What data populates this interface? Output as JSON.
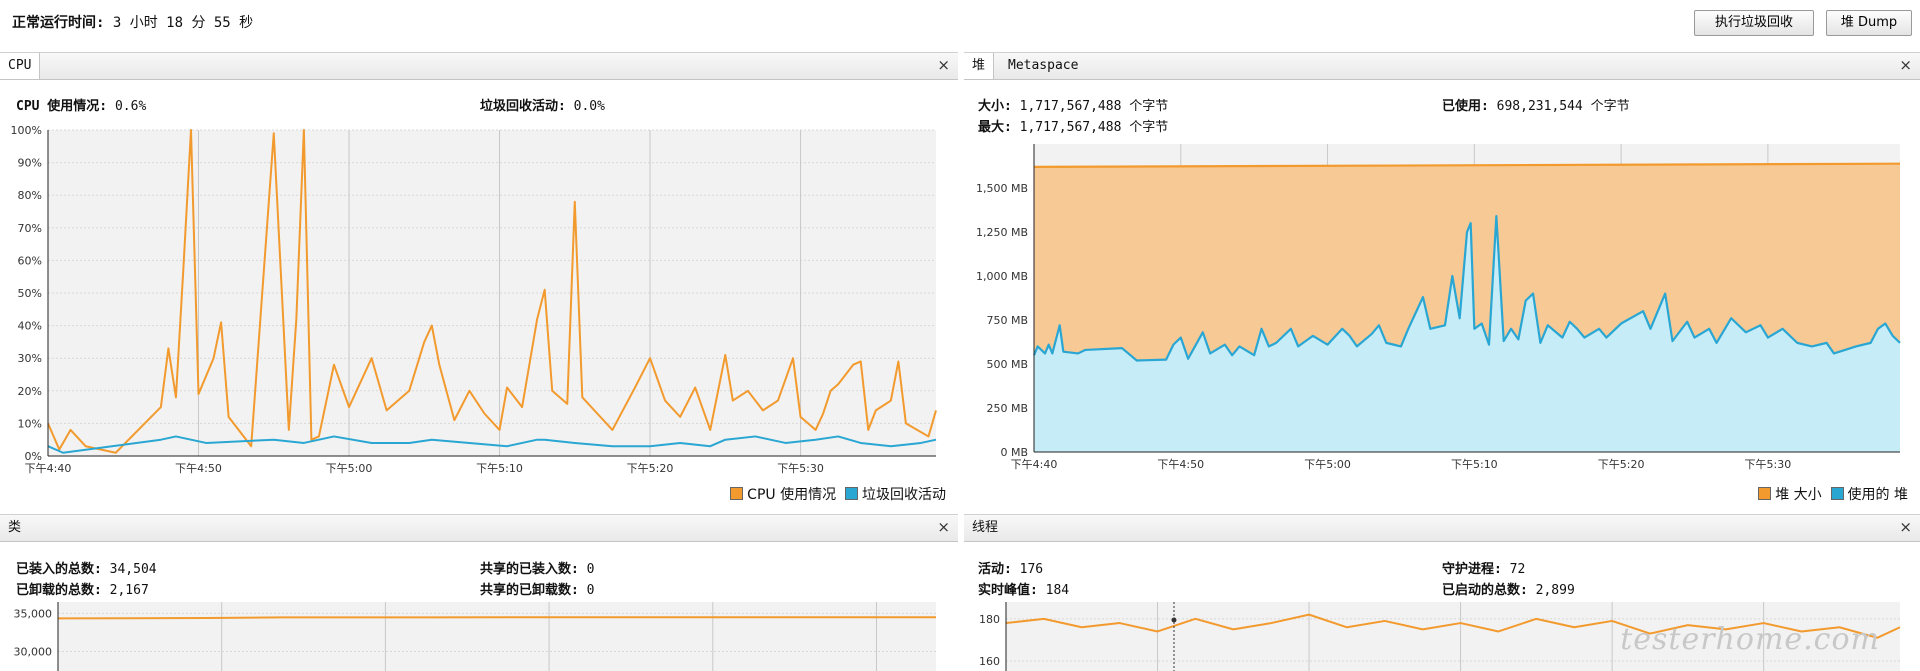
{
  "header": {
    "uptime_label": "正常运行时间:",
    "uptime_value": "3 小时 18 分 55 秒",
    "gc_button": "执行垃圾回收",
    "dump_button": "堆 Dump"
  },
  "cpu_panel": {
    "tab": "CPU",
    "close": "×",
    "cpu_usage_label": "CPU 使用情况:",
    "cpu_usage_value": "0.6%",
    "gc_activity_label": "垃圾回收活动:",
    "gc_activity_value": "0.0%",
    "legend_cpu": "CPU 使用情况",
    "legend_gc": "垃圾回收活动"
  },
  "heap_panel": {
    "tab_heap": "堆",
    "tab_metaspace": "Metaspace",
    "close": "×",
    "size_label": "大小:",
    "size_value": "1,717,567,488 个字节",
    "used_label": "已使用:",
    "used_value": "698,231,544 个字节",
    "max_label": "最大:",
    "max_value": "1,717,567,488 个字节",
    "legend_size": "堆 大小",
    "legend_used": "使用的 堆"
  },
  "classes_panel": {
    "tab": "类",
    "close": "×",
    "loaded_label": "已装入的总数:",
    "loaded_value": "34,504",
    "unloaded_label": "已卸载的总数:",
    "unloaded_value": "2,167",
    "shared_loaded_label": "共享的已装入数:",
    "shared_loaded_value": "0",
    "shared_unloaded_label": "共享的已卸载数:",
    "shared_unloaded_value": "0"
  },
  "threads_panel": {
    "tab": "线程",
    "close": "×",
    "live_label": "活动:",
    "live_value": "176",
    "daemon_label": "守护进程:",
    "daemon_value": "72",
    "peak_label": "实时峰值:",
    "peak_value": "184",
    "started_label": "已启动的总数:",
    "started_value": "2,899"
  },
  "watermark": "testerhome.com",
  "colors": {
    "orange": "#f29a2e",
    "blue": "#2aa6d3",
    "heap_fill": "#f7c995",
    "used_fill": "#c6ecf8"
  },
  "chart_data": [
    {
      "type": "area",
      "title": "CPU",
      "x_ticks": [
        "下午4:40",
        "下午4:50",
        "下午5:00",
        "下午5:10",
        "下午5:20",
        "下午5:30"
      ],
      "y_ticks": [
        "0%",
        "10%",
        "20%",
        "30%",
        "40%",
        "50%",
        "60%",
        "70%",
        "80%",
        "90%",
        "100%"
      ],
      "ylim": [
        0,
        100
      ],
      "series": [
        {
          "name": "CPU 使用情况",
          "color": "#f29a2e",
          "points": [
            [
              0,
              10
            ],
            [
              1.5,
              2
            ],
            [
              3,
              8
            ],
            [
              5,
              3
            ],
            [
              9,
              1
            ],
            [
              15,
              15
            ],
            [
              16,
              33
            ],
            [
              17,
              18
            ],
            [
              18,
              58
            ],
            [
              19,
              100
            ],
            [
              20,
              19
            ],
            [
              22,
              30
            ],
            [
              23,
              41
            ],
            [
              24,
              12
            ],
            [
              27,
              3
            ],
            [
              30,
              99
            ],
            [
              32,
              8
            ],
            [
              33,
              42
            ],
            [
              34,
              100
            ],
            [
              35,
              5
            ],
            [
              36,
              6
            ],
            [
              38,
              28
            ],
            [
              40,
              15
            ],
            [
              43,
              30
            ],
            [
              45,
              14
            ],
            [
              48,
              20
            ],
            [
              50,
              35
            ],
            [
              51,
              40
            ],
            [
              52,
              28
            ],
            [
              54,
              11
            ],
            [
              56,
              20
            ],
            [
              58,
              13
            ],
            [
              60,
              8
            ],
            [
              61,
              21
            ],
            [
              63,
              15
            ],
            [
              65,
              42
            ],
            [
              66,
              51
            ],
            [
              67,
              20
            ],
            [
              69,
              16
            ],
            [
              70,
              78
            ],
            [
              71,
              18
            ],
            [
              73,
              13
            ],
            [
              75,
              8
            ],
            [
              78,
              21
            ],
            [
              80,
              30
            ],
            [
              82,
              17
            ],
            [
              84,
              12
            ],
            [
              86,
              21
            ],
            [
              88,
              8
            ],
            [
              90,
              31
            ],
            [
              91,
              17
            ],
            [
              93,
              20
            ],
            [
              95,
              14
            ],
            [
              97,
              17
            ],
            [
              99,
              30
            ],
            [
              100,
              12
            ],
            [
              102,
              8
            ],
            [
              103,
              13
            ],
            [
              104,
              20
            ],
            [
              105,
              22
            ],
            [
              107,
              28
            ],
            [
              108,
              29
            ],
            [
              109,
              8
            ],
            [
              110,
              14
            ],
            [
              112,
              17
            ],
            [
              113,
              29
            ],
            [
              114,
              10
            ],
            [
              117,
              6
            ],
            [
              118,
              14
            ]
          ]
        },
        {
          "name": "垃圾回收活动",
          "color": "#2aa6d3",
          "points": [
            [
              0,
              3
            ],
            [
              2,
              1
            ],
            [
              15,
              5
            ],
            [
              17,
              6
            ],
            [
              19,
              5
            ],
            [
              21,
              4
            ],
            [
              30,
              5
            ],
            [
              34,
              4
            ],
            [
              38,
              6
            ],
            [
              43,
              4
            ],
            [
              48,
              4
            ],
            [
              51,
              5
            ],
            [
              56,
              4
            ],
            [
              61,
              3
            ],
            [
              65,
              5
            ],
            [
              66,
              5
            ],
            [
              70,
              4
            ],
            [
              75,
              3
            ],
            [
              80,
              3
            ],
            [
              84,
              4
            ],
            [
              88,
              3
            ],
            [
              90,
              5
            ],
            [
              94,
              6
            ],
            [
              98,
              4
            ],
            [
              102,
              5
            ],
            [
              105,
              6
            ],
            [
              108,
              4
            ],
            [
              112,
              3
            ],
            [
              116,
              4
            ],
            [
              118,
              5
            ]
          ]
        }
      ]
    },
    {
      "type": "area",
      "title": "堆",
      "x_ticks": [
        "下午4:40",
        "下午4:50",
        "下午5:00",
        "下午5:10",
        "下午5:20",
        "下午5:30"
      ],
      "y_ticks": [
        "0 MB",
        "250 MB",
        "500 MB",
        "750 MB",
        "1,000 MB",
        "1,250 MB",
        "1,500 MB"
      ],
      "ylim": [
        0,
        1750
      ],
      "series": [
        {
          "name": "堆 大小",
          "color": "#f29a2e",
          "points": [
            [
              0,
              1620
            ],
            [
              118,
              1638
            ]
          ]
        },
        {
          "name": "使用的 堆",
          "color": "#2aa6d3",
          "points": [
            [
              0,
              550
            ],
            [
              0.5,
              600
            ],
            [
              1.5,
              560
            ],
            [
              2,
              610
            ],
            [
              2.5,
              560
            ],
            [
              3,
              640
            ],
            [
              3.5,
              720
            ],
            [
              4,
              570
            ],
            [
              6,
              560
            ],
            [
              7,
              580
            ],
            [
              12,
              590
            ],
            [
              14,
              520
            ],
            [
              18,
              525
            ],
            [
              19,
              610
            ],
            [
              20,
              650
            ],
            [
              21,
              530
            ],
            [
              23,
              680
            ],
            [
              24,
              560
            ],
            [
              26,
              610
            ],
            [
              27,
              550
            ],
            [
              28,
              600
            ],
            [
              30,
              550
            ],
            [
              31,
              700
            ],
            [
              32,
              600
            ],
            [
              33,
              620
            ],
            [
              35,
              700
            ],
            [
              36,
              600
            ],
            [
              38,
              660
            ],
            [
              40,
              610
            ],
            [
              42,
              700
            ],
            [
              43,
              660
            ],
            [
              44,
              600
            ],
            [
              46,
              670
            ],
            [
              47,
              720
            ],
            [
              48,
              620
            ],
            [
              50,
              600
            ],
            [
              51,
              700
            ],
            [
              53,
              880
            ],
            [
              54,
              700
            ],
            [
              56,
              720
            ],
            [
              57,
              1000
            ],
            [
              58,
              760
            ],
            [
              59,
              1250
            ],
            [
              59.5,
              1300
            ],
            [
              60,
              700
            ],
            [
              61,
              730
            ],
            [
              62,
              610
            ],
            [
              63,
              1340
            ],
            [
              64,
              630
            ],
            [
              65,
              700
            ],
            [
              66,
              640
            ],
            [
              67,
              860
            ],
            [
              68,
              900
            ],
            [
              69,
              620
            ],
            [
              70,
              720
            ],
            [
              72,
              650
            ],
            [
              73,
              740
            ],
            [
              74,
              700
            ],
            [
              75,
              650
            ],
            [
              77,
              700
            ],
            [
              78,
              650
            ],
            [
              80,
              730
            ],
            [
              83,
              800
            ],
            [
              84,
              700
            ],
            [
              86,
              900
            ],
            [
              87,
              630
            ],
            [
              89,
              740
            ],
            [
              90,
              650
            ],
            [
              92,
              700
            ],
            [
              93,
              620
            ],
            [
              95,
              760
            ],
            [
              97,
              680
            ],
            [
              99,
              720
            ],
            [
              100,
              650
            ],
            [
              102,
              700
            ],
            [
              104,
              620
            ],
            [
              106,
              600
            ],
            [
              108,
              620
            ],
            [
              109,
              560
            ],
            [
              112,
              600
            ],
            [
              114,
              620
            ],
            [
              115,
              700
            ],
            [
              116,
              730
            ],
            [
              117,
              660
            ],
            [
              118,
              620
            ]
          ]
        }
      ]
    },
    {
      "type": "line",
      "title": "类",
      "y_ticks": [
        "30,000",
        "35,000"
      ],
      "series": [
        {
          "name": "",
          "color": "#f29a2e",
          "points": [
            [
              0,
              34350
            ],
            [
              20,
              34400
            ],
            [
              30,
              34480
            ],
            [
              50,
              34490
            ],
            [
              80,
              34500
            ],
            [
              118,
              34504
            ]
          ]
        }
      ]
    },
    {
      "type": "line",
      "title": "线程",
      "y_ticks": [
        "160",
        "180"
      ],
      "series": [
        {
          "name": "",
          "color": "#f29a2e",
          "points": [
            [
              0,
              178
            ],
            [
              5,
              180
            ],
            [
              10,
              176
            ],
            [
              15,
              178
            ],
            [
              20,
              174
            ],
            [
              25,
              180
            ],
            [
              30,
              175
            ],
            [
              35,
              178
            ],
            [
              40,
              182
            ],
            [
              45,
              176
            ],
            [
              50,
              179
            ],
            [
              55,
              175
            ],
            [
              60,
              178
            ],
            [
              65,
              174
            ],
            [
              70,
              180
            ],
            [
              75,
              176
            ],
            [
              80,
              179
            ],
            [
              85,
              173
            ],
            [
              90,
              177
            ],
            [
              95,
              175
            ],
            [
              100,
              178
            ],
            [
              105,
              174
            ],
            [
              110,
              176
            ],
            [
              115,
              171
            ],
            [
              118,
              176
            ]
          ]
        }
      ]
    }
  ]
}
